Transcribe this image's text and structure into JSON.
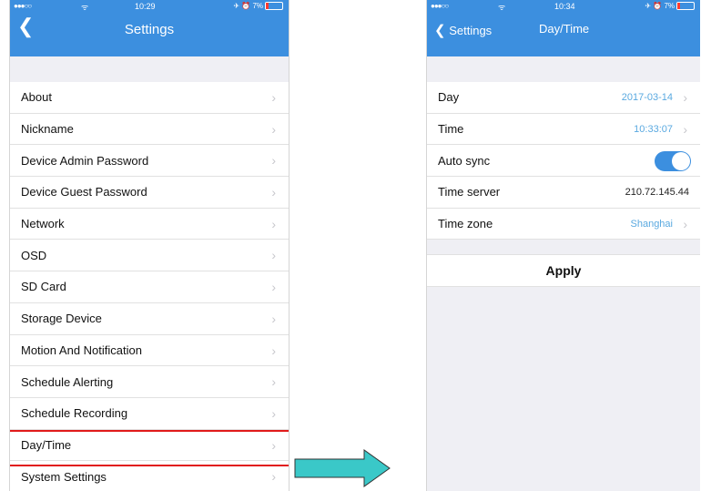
{
  "left": {
    "status": {
      "signal": "●●●○○",
      "wifi": "ᯤ",
      "time": "10:29",
      "battery": "✈ ⏰ 7%"
    },
    "title": "Settings",
    "items": [
      {
        "label": "About"
      },
      {
        "label": "Nickname"
      },
      {
        "label": "Device Admin Password"
      },
      {
        "label": "Device Guest Password"
      },
      {
        "label": "Network"
      },
      {
        "label": "OSD"
      },
      {
        "label": "SD Card"
      },
      {
        "label": "Storage Device"
      },
      {
        "label": "Motion And Notification"
      },
      {
        "label": "Schedule Alerting"
      },
      {
        "label": "Schedule Recording"
      },
      {
        "label": "Day/Time"
      },
      {
        "label": "System Settings"
      }
    ]
  },
  "right": {
    "status": {
      "signal": "●●●○○",
      "wifi": "ᯤ",
      "time": "10:34",
      "battery": "✈ ⏰ 7%"
    },
    "back_label": "Settings",
    "title": "Day/Time",
    "rows": {
      "day": {
        "label": "Day",
        "value": "2017-03-14"
      },
      "time": {
        "label": "Time",
        "value": "10:33:07"
      },
      "auto_sync": {
        "label": "Auto sync",
        "on": true
      },
      "time_server": {
        "label": "Time server",
        "value": "210.72.145.44"
      },
      "time_zone": {
        "label": "Time zone",
        "value": "Shanghai"
      }
    },
    "apply_label": "Apply"
  },
  "colors": {
    "accent": "#3c8fdf",
    "highlight": "#e11b1b",
    "arrow": "#3ac8c8"
  }
}
